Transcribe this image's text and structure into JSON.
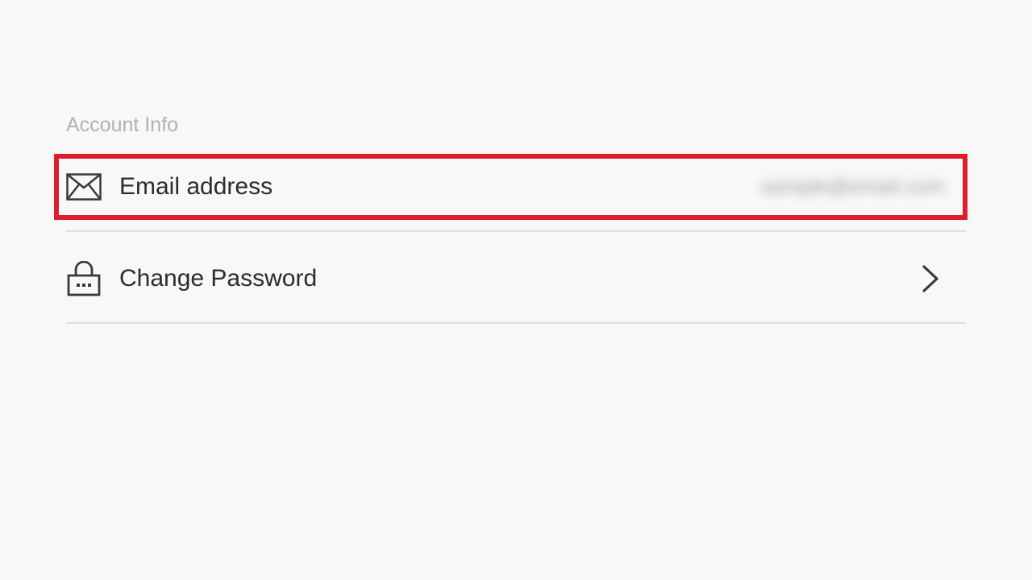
{
  "section": {
    "title": "Account Info"
  },
  "rows": [
    {
      "label": "Email address",
      "icon": "envelope-icon",
      "value": "sample@email.com"
    },
    {
      "label": "Change Password",
      "icon": "lock-icon",
      "trailing_icon": "chevron-right-icon"
    }
  ],
  "colors": {
    "background": "#f8f8f8",
    "highlight": "#e01e2b",
    "text": "#2c2c2e",
    "section_text": "#b1b1b1",
    "divider": "#dedede"
  }
}
